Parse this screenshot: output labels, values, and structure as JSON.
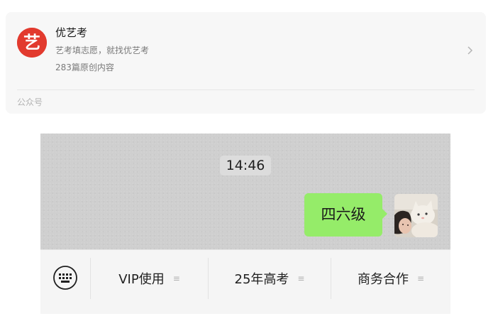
{
  "official_account": {
    "logo_icon": "yi-character-logo-icon",
    "logo_glyph": "艺",
    "logo_color": "#e23a2e",
    "name": "优艺考",
    "description": "艺考填志愿，就找优艺考",
    "article_count": "283篇原创内容",
    "type_label": "公众号"
  },
  "chat": {
    "time": "14:46",
    "message": "四六级",
    "bubble_color": "#95ec69",
    "avatar_icon": "cat-avatar-icon"
  },
  "menu": {
    "keyboard_icon": "keyboard-icon",
    "items": [
      {
        "label": "VIP使用",
        "icon": "submenu-lines-icon"
      },
      {
        "label": "25年高考",
        "icon": "submenu-lines-icon"
      },
      {
        "label": "商务合作",
        "icon": "submenu-lines-icon"
      }
    ],
    "submenu_glyph": "≡"
  }
}
